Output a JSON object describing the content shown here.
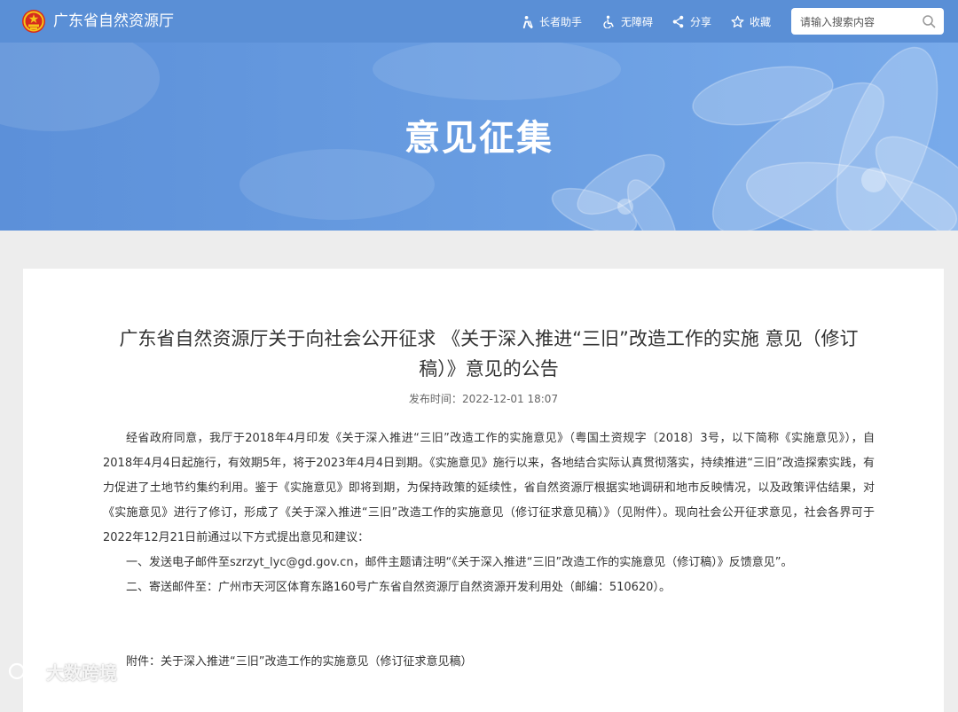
{
  "header": {
    "site_title": "广东省自然资源厅",
    "nav": [
      {
        "label": "长者助手",
        "icon": "elder-helper-icon"
      },
      {
        "label": "无障碍",
        "icon": "accessibility-icon"
      },
      {
        "label": "分享",
        "icon": "share-icon"
      },
      {
        "label": "收藏",
        "icon": "star-icon"
      }
    ],
    "search": {
      "placeholder": "请输入搜索内容",
      "value": "",
      "icon": "search-icon"
    }
  },
  "banner": {
    "title": "意见征集"
  },
  "article": {
    "title": "广东省自然资源厅关于向社会公开征求 《关于深入推进“三旧”改造工作的实施 意见（修订稿）》意见的公告",
    "publish_label": "发布时间：",
    "publish_time": "2022-12-01 18:07",
    "paragraphs": [
      "经省政府同意，我厅于2018年4月印发《关于深入推进“三旧”改造工作的实施意见》（粤国土资规字〔2018〕3号，以下简称《实施意见》），自2018年4月4日起施行，有效期5年，将于2023年4月4日到期。《实施意见》施行以来，各地结合实际认真贯彻落实，持续推进“三旧”改造探索实践，有力促进了土地节约集约利用。鉴于《实施意见》即将到期，为保持政策的延续性，省自然资源厅根据实地调研和地市反映情况，以及政策评估结果，对《实施意见》进行了修订，形成了《关于深入推进“三旧”改造工作的实施意见（修订征求意见稿）》（见附件）。现向社会公开征求意见，社会各界可于2022年12月21日前通过以下方式提出意见和建议：",
      "一、发送电子邮件至szrzyt_lyc@gd.gov.cn，邮件主题请注明“《关于深入推进“三旧”改造工作的实施意见（修订稿）》反馈意见”。",
      "二、寄送邮件至：广州市天河区体育东路160号广东省自然资源厅自然资源开发利用处（邮编：510620）。"
    ],
    "attachment": "附件：关于深入推进“三旧”改造工作的实施意见（修订征求意见稿）"
  },
  "watermark": {
    "text": "大数跨境"
  },
  "colors": {
    "header_bg": "#5a8fd6",
    "banner_bg": "#6a9ee2",
    "page_bg": "#ededed",
    "text": "#333333"
  }
}
